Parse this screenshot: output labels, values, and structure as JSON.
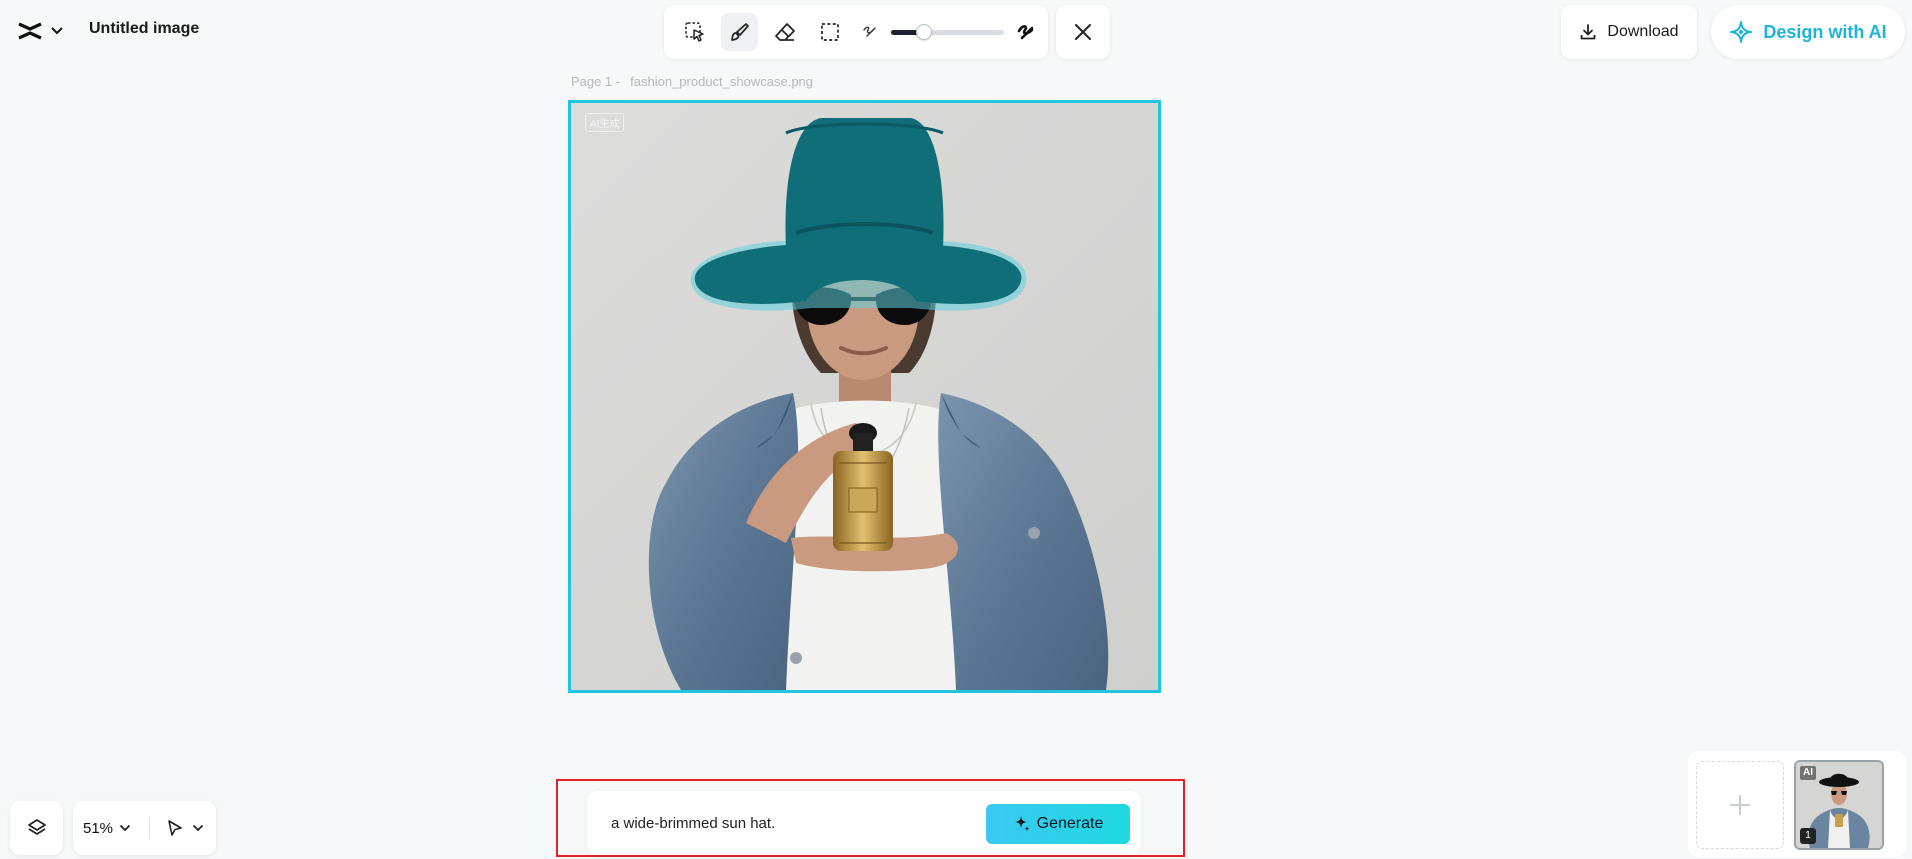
{
  "header": {
    "title": "Untitled image",
    "logo_icon": "capcut-logo-icon",
    "download_label": "Download",
    "design_ai_label": "Design with AI"
  },
  "toolbar": {
    "tools": [
      "lasso-select-icon",
      "brush-icon",
      "eraser-icon",
      "rect-select-icon"
    ],
    "active_tool": "brush-icon",
    "brush_size_level": 0.25,
    "close_icon": "close-icon"
  },
  "canvas": {
    "page_label": "Page 1 -",
    "file_name": "fashion_product_showcase.png",
    "watermark": "AI生成",
    "accent_color": "#23c4e0",
    "mask_color": "#0f6e78"
  },
  "bottom_left": {
    "zoom": "51%",
    "layers_icon": "layers-icon",
    "pointer_icon": "pointer-icon"
  },
  "prompt": {
    "value": "a wide-brimmed sun hat.",
    "generate_label": "Generate",
    "highlight_color": "#e0232b"
  },
  "pages": {
    "thumb_badge": "AI",
    "thumb_number": "1"
  }
}
